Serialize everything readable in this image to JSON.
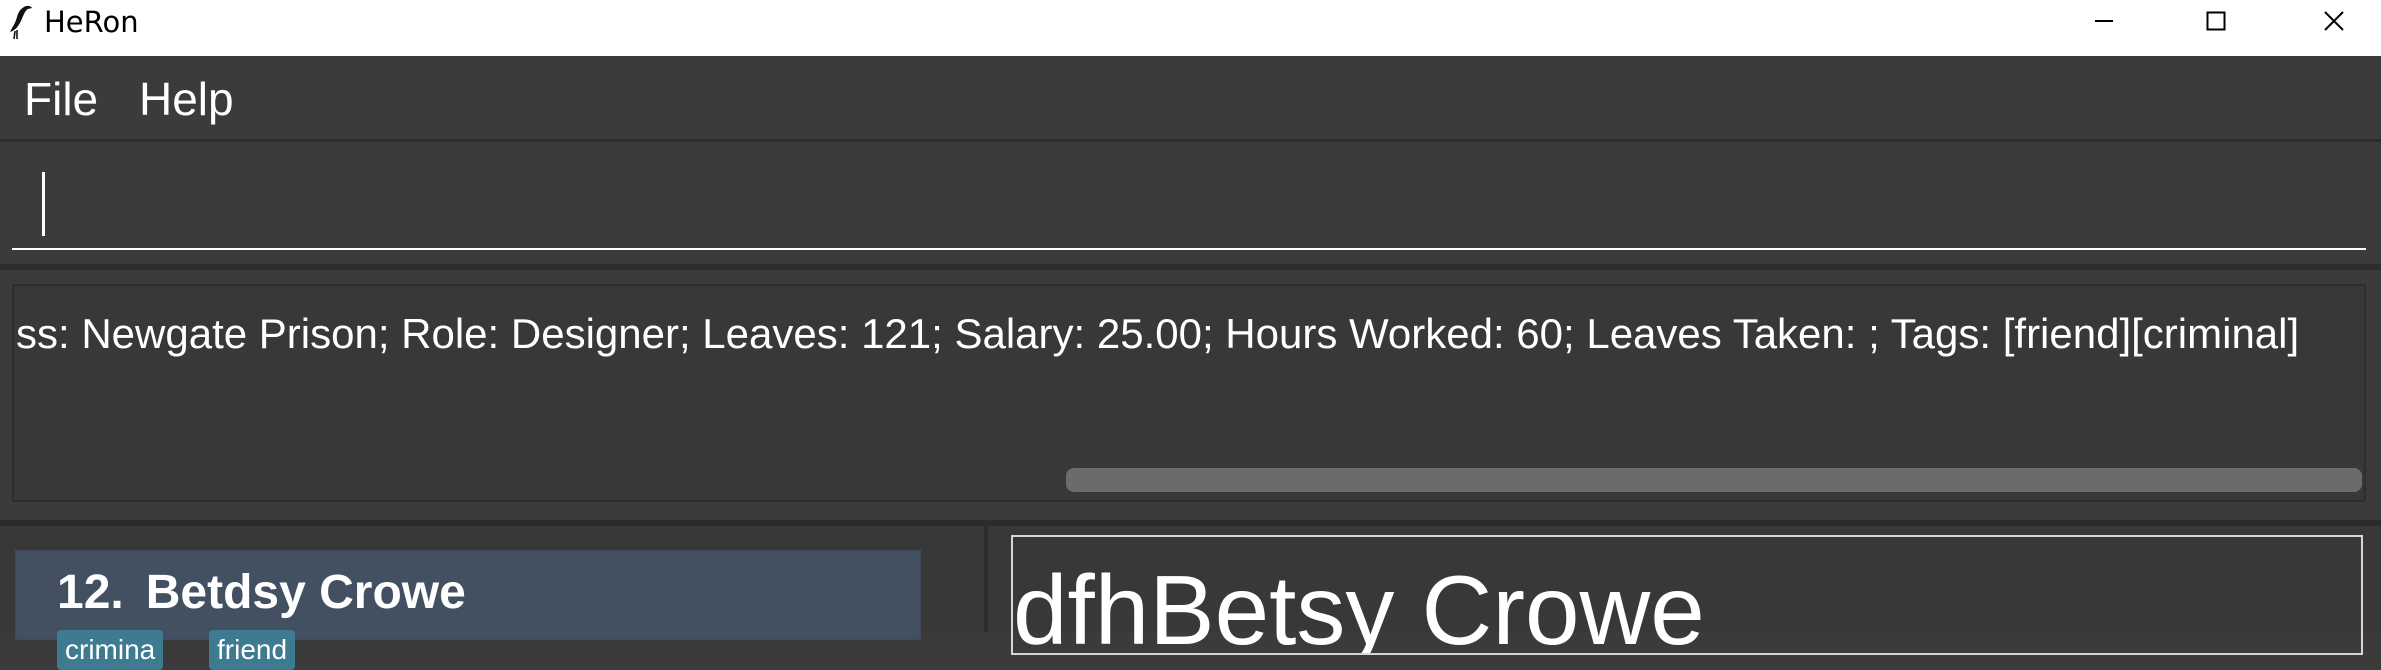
{
  "window": {
    "title": "HeRon",
    "icon": "heron-bird-icon"
  },
  "menu": {
    "file_label": "File",
    "help_label": "Help"
  },
  "command": {
    "value": ""
  },
  "result": {
    "text": "ss: Newgate Prison; Role: Designer; Leaves: 121; Salary: 25.00; Hours Worked: 60; Leaves Taken: ; Tags: [friend][criminal]"
  },
  "person_list": {
    "items": [
      {
        "index": "12.",
        "name": "Betdsy Crowe",
        "tags": [
          "crimina",
          "friend"
        ]
      }
    ]
  },
  "detail": {
    "name": "dfhBetsy Crowe"
  },
  "colors": {
    "background": "#3b3b3b",
    "card_selected": "#435061",
    "tag": "#3e7b91"
  }
}
